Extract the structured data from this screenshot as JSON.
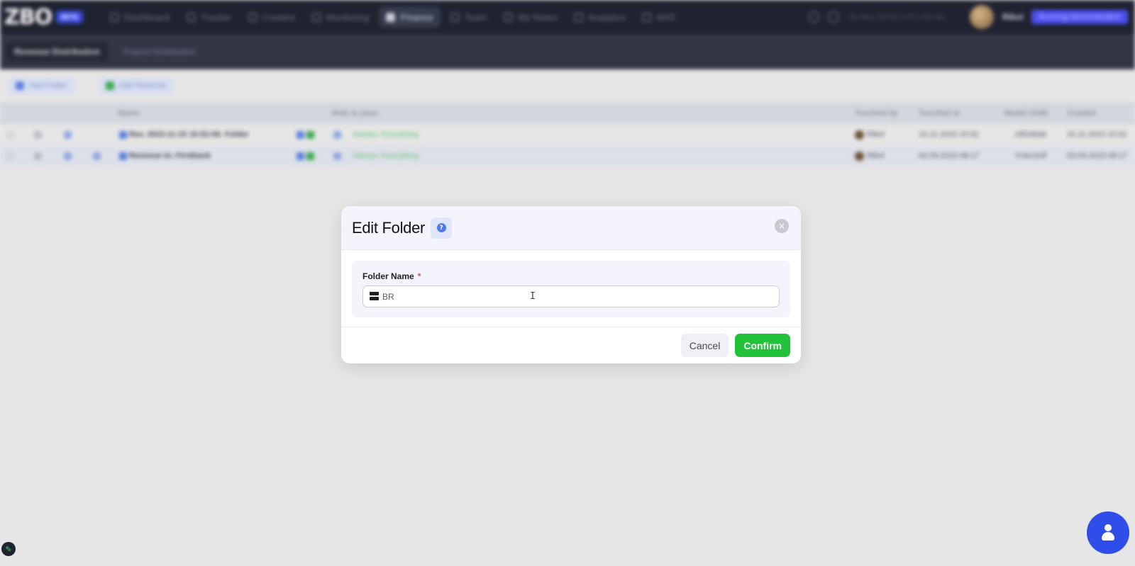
{
  "app": {
    "logo": "ZBO",
    "logo_badge": "BETA"
  },
  "nav": {
    "items": [
      {
        "label": "Dashboard"
      },
      {
        "label": "Tracker"
      },
      {
        "label": "Content"
      },
      {
        "label": "Monitoring"
      },
      {
        "label": "Finance"
      },
      {
        "label": "Team"
      },
      {
        "label": "My Notes"
      },
      {
        "label": "Analytics"
      },
      {
        "label": "AKR"
      }
    ],
    "active_index": 4
  },
  "topright": {
    "status_text": "15 Nov 16:52 UTC+01:00",
    "user": "Rikol",
    "badge": "Running Demonstration"
  },
  "subtabs": [
    {
      "label": "Revenue Distribution"
    },
    {
      "label": "Payout Distribution"
    }
  ],
  "toolbar": {
    "add_folder": "Add Folder",
    "add_revenue": "Add Revenue"
  },
  "table": {
    "headers": {
      "name": "Name",
      "rule": "Rule to pass",
      "touched_by": "Touched by",
      "touched_at": "Touched at",
      "model_uuid": "Model UUID",
      "created": "Created"
    },
    "rows": [
      {
        "name": "Rev. 2023-11-15 15:52:06: Folder",
        "rule": "Always: Everything",
        "touched_by": "Rikol",
        "touched_at": "15.11.2023 15:52",
        "model_uuid": "c8f2d9a6",
        "created": "15.11.2023 15:52"
      },
      {
        "name": "Revenue to: Firstback",
        "rule": "Always: Everything",
        "touched_by": "Rikol",
        "touched_at": "03.09.2023 08:17",
        "model_uuid": "7c9e1b3f",
        "created": "03.09.2023 08:17"
      }
    ]
  },
  "modal": {
    "title": "Edit Folder",
    "help_glyph": "?",
    "close_glyph": "×",
    "field_label": "Folder Name",
    "required_mark": "*",
    "input_value": "BR",
    "cursor_glyph": "I",
    "cancel_label": "Cancel",
    "confirm_label": "Confirm"
  },
  "colors": {
    "confirm_green": "#22c33a",
    "help_blue": "#4e7be8",
    "required_red": "#e5484d",
    "fab_blue": "#2f4de8"
  },
  "icons": {
    "folder_name_field": "server-icon",
    "help": "question-circle-icon",
    "close": "close-circle-icon",
    "float": "user-support-icon",
    "edit": "pencil-icon"
  }
}
